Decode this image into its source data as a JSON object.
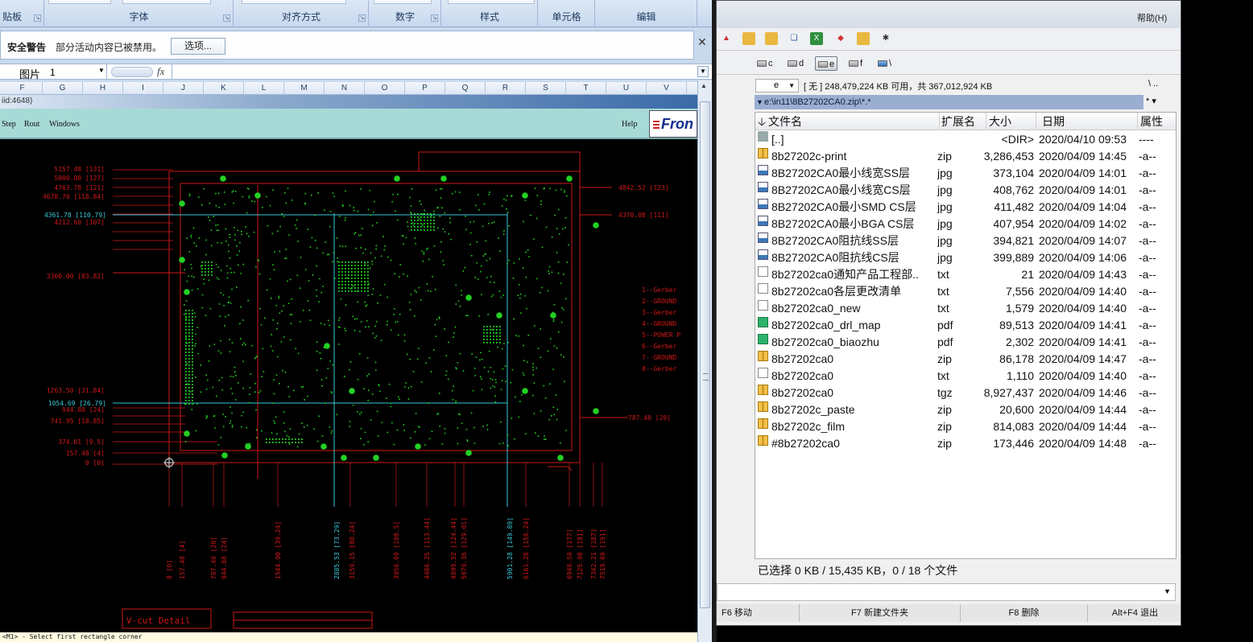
{
  "excel": {
    "ribbon_groups": [
      "贴板",
      "字体",
      "对齐方式",
      "数字",
      "样式",
      "单元格",
      "编辑"
    ],
    "security": {
      "title": "安全警告",
      "message": "部分活动内容已被禁用。",
      "options_button": "选项..."
    },
    "namebox": {
      "name": "图片",
      "index": "1"
    },
    "fx": "fx",
    "columns": [
      "F",
      "G",
      "H",
      "I",
      "J",
      "K",
      "L",
      "M",
      "N",
      "O",
      "P",
      "Q",
      "R",
      "S",
      "T",
      "U",
      "V"
    ]
  },
  "cam": {
    "title_fragment": "iid:4648)",
    "menu": [
      "Step",
      "Rout",
      "Windows"
    ],
    "help": "Help",
    "logo": "Fron",
    "status": "<M1> - Select first rectangle corner",
    "vcut_label": "V-cut Detail",
    "left_dims": [
      "5157.48 [131]",
      "5000.00 [127]",
      "4763.78 [121]",
      "4678.70 [118.84]",
      "4212.60 [107]",
      "3300.00 [83.82]",
      "1263.50 [31.84]",
      "944.88 [24]",
      "741.95 [18.85]",
      "374.01 [9.5]",
      "157.48 [4]",
      "0 [0]"
    ],
    "left_dims_cyan": [
      "4361.78 [110.79]",
      "1054.69 [26.79]"
    ],
    "right_dims": [
      "4842.52 [123]",
      "4370.08 [111]",
      "787.40 [20]"
    ],
    "layer_legend": [
      "1--Gerber",
      "2--GROUND",
      "3--Gerber",
      "4--GROUND",
      "5--POWER P",
      "6--Gerber",
      "7--GROUND",
      "8--Gerber"
    ],
    "bottom_dims": [
      "0 [0]",
      "157.48 [4]",
      "787.40 [20]",
      "944.88 [24]",
      "1544.90 [39.24]",
      "2885.53 [73.29]",
      "3159.15 [80.24]",
      "3956.69 [100.5]",
      "4486.25 [113.44]",
      "4899.52 [124.44]",
      "5079.36 [129.01]",
      "5901.28 [149.89]",
      "6161.28 [156.24]",
      "6948.50 [177]",
      "7125.98 [181]",
      "7342.21 [187]",
      "7519.69 [191]"
    ],
    "bottom_dims_cyan": [
      "2885.53 [73.29]",
      "5901.28 [149.89]"
    ]
  },
  "fm": {
    "help_menu": "帮助(H)",
    "drives": [
      "c",
      "d",
      "e",
      "f",
      "\\"
    ],
    "selected_drive": "e",
    "path_drive": "e",
    "free_space": "[ 无 ] 248,479,224 KB 可用，共 367,012,924 KB",
    "nav_back": "\\   ..",
    "current_path": "e:\\in11\\8B27202CA0.zip\\*.*",
    "filter": "*  ▾",
    "headers": {
      "name": "文件名",
      "ext": "扩展名",
      "size": "大小",
      "date": "日期",
      "attr": "属性"
    },
    "files": [
      {
        "name": "[..]",
        "ext": "",
        "size": "<DIR>",
        "date": "2020/04/10 09:53",
        "attr": "----",
        "icon": "up-icon"
      },
      {
        "name": "8b27202c-print",
        "ext": "zip",
        "size": "3,286,453",
        "date": "2020/04/09 14:45",
        "attr": "-a--",
        "icon": "zip-icon"
      },
      {
        "name": "8B27202CA0最小线宽SS层",
        "ext": "jpg",
        "size": "373,104",
        "date": "2020/04/09 14:01",
        "attr": "-a--",
        "icon": "image-icon"
      },
      {
        "name": "8B27202CA0最小线宽CS层",
        "ext": "jpg",
        "size": "408,762",
        "date": "2020/04/09 14:01",
        "attr": "-a--",
        "icon": "image-icon"
      },
      {
        "name": "8B27202CA0最小SMD CS层",
        "ext": "jpg",
        "size": "411,482",
        "date": "2020/04/09 14:04",
        "attr": "-a--",
        "icon": "image-icon"
      },
      {
        "name": "8B27202CA0最小BGA CS层",
        "ext": "jpg",
        "size": "407,954",
        "date": "2020/04/09 14:02",
        "attr": "-a--",
        "icon": "image-icon"
      },
      {
        "name": "8B27202CA0阻抗线SS层",
        "ext": "jpg",
        "size": "394,821",
        "date": "2020/04/09 14:07",
        "attr": "-a--",
        "icon": "image-icon"
      },
      {
        "name": "8B27202CA0阻抗线CS层",
        "ext": "jpg",
        "size": "399,889",
        "date": "2020/04/09 14:06",
        "attr": "-a--",
        "icon": "image-icon"
      },
      {
        "name": "8b27202ca0通知产品工程部..",
        "ext": "txt",
        "size": "21",
        "date": "2020/04/09 14:43",
        "attr": "-a--",
        "icon": "text-file-icon"
      },
      {
        "name": "8b27202ca0各层更改清单",
        "ext": "txt",
        "size": "7,556",
        "date": "2020/04/09 14:40",
        "attr": "-a--",
        "icon": "text-file-icon"
      },
      {
        "name": "8b27202ca0_new",
        "ext": "txt",
        "size": "1,579",
        "date": "2020/04/09 14:40",
        "attr": "-a--",
        "icon": "text-file-icon"
      },
      {
        "name": "8b27202ca0_drl_map",
        "ext": "pdf",
        "size": "89,513",
        "date": "2020/04/09 14:41",
        "attr": "-a--",
        "icon": "pdf-icon"
      },
      {
        "name": "8b27202ca0_biaozhu",
        "ext": "pdf",
        "size": "2,302",
        "date": "2020/04/09 14:41",
        "attr": "-a--",
        "icon": "pdf-icon"
      },
      {
        "name": "8b27202ca0",
        "ext": "zip",
        "size": "86,178",
        "date": "2020/04/09 14:47",
        "attr": "-a--",
        "icon": "zip-icon"
      },
      {
        "name": "8b27202ca0",
        "ext": "txt",
        "size": "1,110",
        "date": "2020/04/09 14:40",
        "attr": "-a--",
        "icon": "text-file-icon"
      },
      {
        "name": "8b27202ca0",
        "ext": "tgz",
        "size": "8,927,437",
        "date": "2020/04/09 14:46",
        "attr": "-a--",
        "icon": "zip-icon"
      },
      {
        "name": "8b27202c_paste",
        "ext": "zip",
        "size": "20,600",
        "date": "2020/04/09 14:44",
        "attr": "-a--",
        "icon": "zip-icon"
      },
      {
        "name": "8b27202c_film",
        "ext": "zip",
        "size": "814,083",
        "date": "2020/04/09 14:44",
        "attr": "-a--",
        "icon": "zip-icon"
      },
      {
        "name": "#8b27202ca0",
        "ext": "zip",
        "size": "173,446",
        "date": "2020/04/09 14:48",
        "attr": "-a--",
        "icon": "zip-icon"
      }
    ],
    "status": "已选择 0 KB / 15,435 KB，0 / 18 个文件",
    "fkeys": [
      "F6 移动",
      "F7 新建文件夹",
      "F8 删除",
      "Alt+F4 退出"
    ]
  }
}
